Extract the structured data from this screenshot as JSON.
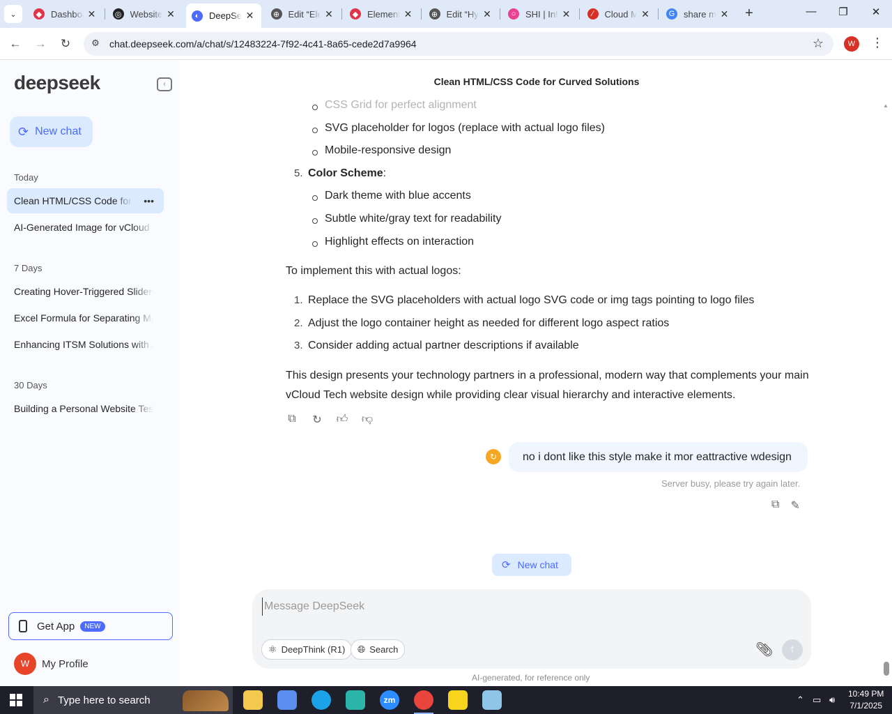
{
  "browser": {
    "tabs": [
      {
        "label": "Dashboard",
        "fav_color": "#e0344a",
        "fav": "◆"
      },
      {
        "label": "Website",
        "fav_color": "#222222",
        "fav": "◎"
      },
      {
        "label": "DeepSeek",
        "fav_color": "#4d6bfe",
        "fav": "◐",
        "active": true
      },
      {
        "label": "Edit “Elementor",
        "fav_color": "#555555",
        "fav": "⊕"
      },
      {
        "label": "Elementor",
        "fav_color": "#e0344a",
        "fav": "◆"
      },
      {
        "label": "Edit “Hybrid",
        "fav_color": "#555555",
        "fav": "⊕"
      },
      {
        "label": "SHI | Info",
        "fav_color": "#e84393",
        "fav": "○"
      },
      {
        "label": "Cloud M",
        "fav_color": "#d93025",
        "fav": "∕"
      },
      {
        "label": "share m",
        "fav_color": "#4285f4",
        "fav": "G"
      }
    ],
    "url": "chat.deepseek.com/a/chat/s/12483224-7f92-4c41-8a65-cede2d7a9964",
    "profile_initial": "W"
  },
  "sidebar": {
    "logo": "deepseek",
    "new_chat": "New chat",
    "sections": [
      {
        "label": "Today",
        "items": [
          {
            "label": "Clean HTML/CSS Code for Curved Solutions",
            "active": true
          },
          {
            "label": "AI-Generated Image for vCloud Tech"
          }
        ]
      },
      {
        "label": "7 Days",
        "items": [
          {
            "label": "Creating Hover-Triggered Slider Effect"
          },
          {
            "label": "Excel Formula for Separating Mail"
          },
          {
            "label": "Enhancing ITSM Solutions with AI"
          }
        ]
      },
      {
        "label": "30 Days",
        "items": [
          {
            "label": "Building a Personal Website Test"
          }
        ]
      }
    ],
    "get_app": "Get App",
    "get_app_badge": "NEW",
    "profile_initial": "W",
    "profile_label": "My Profile"
  },
  "chat": {
    "title": "Clean HTML/CSS Code for Curved Solutions",
    "bullets_a": [
      "CSS Grid for perfect alignment",
      "SVG placeholder for logos (replace with actual logo files)",
      "Mobile-responsive design"
    ],
    "item5_number": "5.",
    "item5_bold": "Color Scheme",
    "item5_colon": ":",
    "bullets_b": [
      "Dark theme with blue accents",
      "Subtle white/gray text for readability",
      "Highlight effects on interaction"
    ],
    "implement_intro": "To implement this with actual logos:",
    "steps": [
      {
        "n": "1.",
        "text": "Replace the SVG placeholders with actual logo SVG code or img tags pointing to logo files"
      },
      {
        "n": "2.",
        "text": "Adjust the logo container height as needed for different logo aspect ratios"
      },
      {
        "n": "3.",
        "text": "Consider adding actual partner descriptions if available"
      }
    ],
    "closing": "This design presents your technology partners in a professional, modern way that complements your main vCloud Tech website design while providing clear visual hierarchy and interactive elements.",
    "user_message": "no i dont like this style make it mor eattractive wdesign",
    "server_busy": "Server busy, please try again later.",
    "new_chat_pill": "New chat",
    "composer_placeholder": "Message DeepSeek",
    "deepthink": "DeepThink (R1)",
    "search": "Search",
    "disclaimer": "AI-generated, for reference only"
  },
  "taskbar": {
    "search_placeholder": "Type here to search",
    "time": "10:49 PM",
    "date": "7/1/2025"
  }
}
